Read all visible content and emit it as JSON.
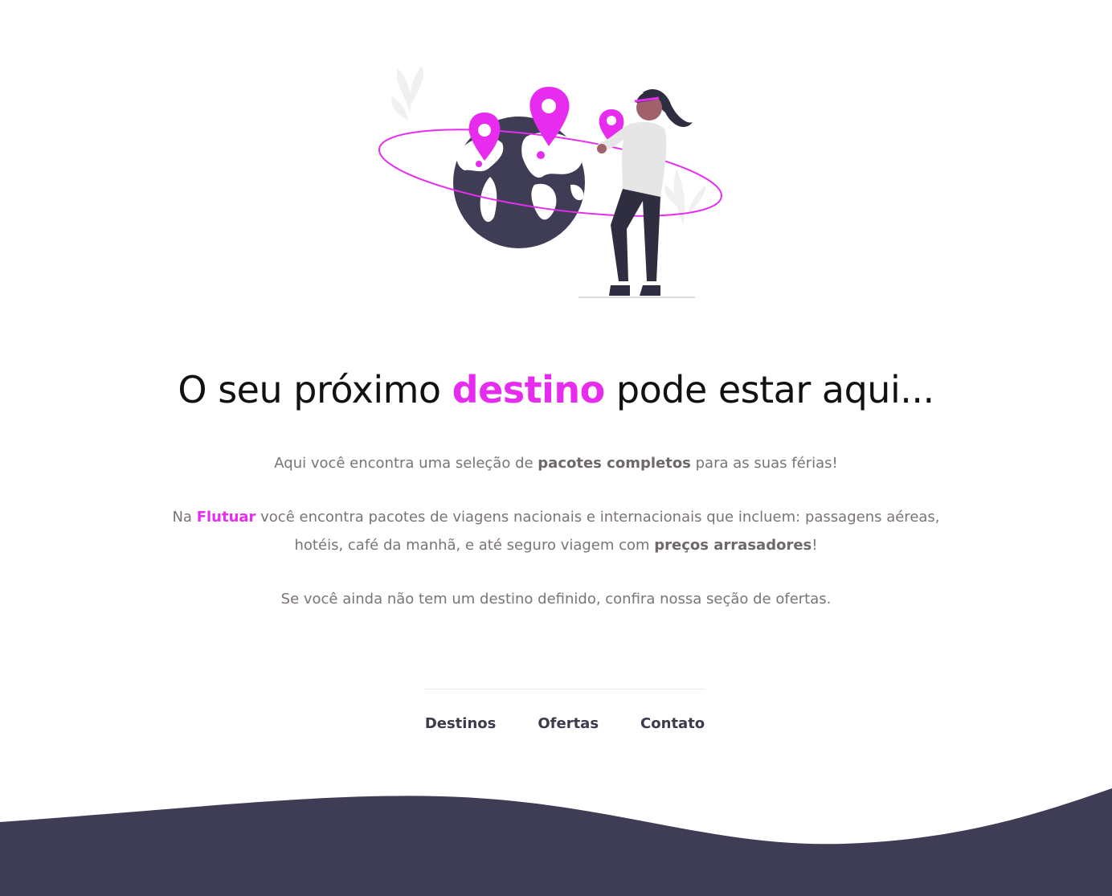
{
  "headline": {
    "before": "O seu próximo ",
    "accent": "destino",
    "after": " pode estar aqui..."
  },
  "intro": {
    "line1_before": "Aqui você encontra uma seleção de ",
    "line1_bold": "pacotes completos",
    "line1_after": " para as suas férias!",
    "line2_before": "Na ",
    "line2_brand": "Flutuar",
    "line2_mid": " você encontra pacotes de viagens nacionais e internacionais que incluem: passagens aéreas, hotéis, café da manhã, e até seguro viagem com ",
    "line2_bold": "preços arrasadores",
    "line2_after": "!",
    "line3": "Se você ainda não tem um destino definido, confira nossa seção de ofertas."
  },
  "nav": {
    "items": [
      "Destinos",
      "Ofertas",
      "Contato"
    ]
  },
  "colors": {
    "accent": "#e72cf0",
    "dark": "#3f3d56",
    "text": "#7a7474"
  },
  "icons": [
    "globe-illustration",
    "map-pin-icon",
    "traveler-woman-illustration",
    "leaf-decoration"
  ]
}
